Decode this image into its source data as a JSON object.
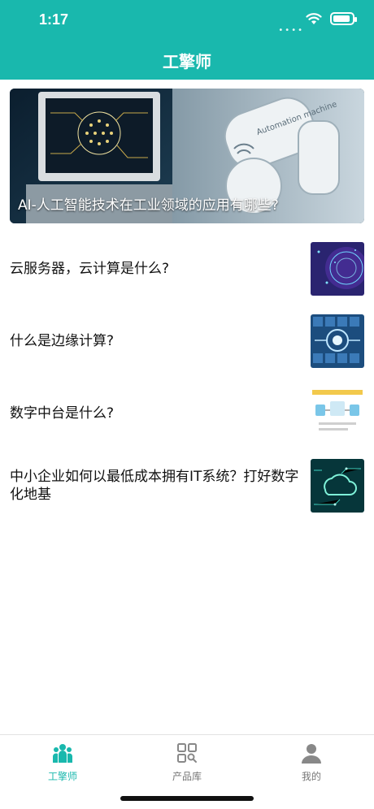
{
  "status_bar": {
    "time": "1:17"
  },
  "header": {
    "title": "工擎师"
  },
  "banner": {
    "title": "AI-人工智能技术在工业领域的应用有哪些?",
    "image_text": "Automation machine"
  },
  "articles": [
    {
      "title": "云服务器，云计算是什么?"
    },
    {
      "title": "什么是边缘计算?"
    },
    {
      "title": "数字中台是什么?"
    },
    {
      "title": "中小企业如何以最低成本拥有IT系统？打好数字化地基"
    }
  ],
  "tabbar": {
    "tabs": [
      {
        "label": "工擎师",
        "icon": "team-icon",
        "active": true
      },
      {
        "label": "产品库",
        "icon": "grid-search-icon",
        "active": false
      },
      {
        "label": "我的",
        "icon": "person-icon",
        "active": false
      }
    ]
  },
  "colors": {
    "accent": "#19b8ad"
  }
}
